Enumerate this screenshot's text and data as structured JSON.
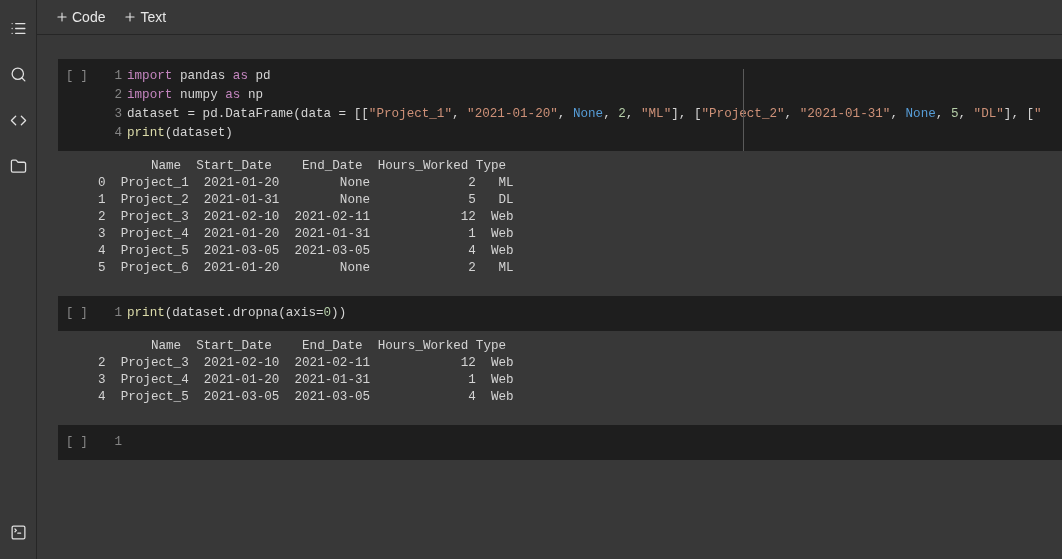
{
  "toolbar": {
    "buttons": [
      {
        "label": "Code"
      },
      {
        "label": "Text"
      }
    ]
  },
  "cells": [
    {
      "run_marker": "[ ]",
      "lines": [
        {
          "number": "1",
          "tokens": [
            {
              "t": "import",
              "kind": "keyword"
            },
            {
              "t": " pandas ",
              "kind": "plain"
            },
            {
              "t": "as",
              "kind": "keyword"
            },
            {
              "t": " pd",
              "kind": "plain"
            }
          ]
        },
        {
          "number": "2",
          "tokens": [
            {
              "t": "import",
              "kind": "keyword"
            },
            {
              "t": " numpy ",
              "kind": "plain"
            },
            {
              "t": "as",
              "kind": "keyword"
            },
            {
              "t": " np",
              "kind": "plain"
            }
          ]
        },
        {
          "number": "3",
          "tokens": [
            {
              "t": "dataset = pd.DataFrame(data = [[",
              "kind": "plain"
            },
            {
              "t": "\"Project_1\"",
              "kind": "string"
            },
            {
              "t": ", ",
              "kind": "plain"
            },
            {
              "t": "\"2021-01-20\"",
              "kind": "string"
            },
            {
              "t": ", ",
              "kind": "plain"
            },
            {
              "t": "None",
              "kind": "constant"
            },
            {
              "t": ", ",
              "kind": "plain"
            },
            {
              "t": "2",
              "kind": "number"
            },
            {
              "t": ", ",
              "kind": "plain"
            },
            {
              "t": "\"ML\"",
              "kind": "string"
            },
            {
              "t": "], [",
              "kind": "plain"
            },
            {
              "t": "\"Project_2\"",
              "kind": "string"
            },
            {
              "t": ", ",
              "kind": "plain"
            },
            {
              "t": "\"2021-01-31\"",
              "kind": "string"
            },
            {
              "t": ", ",
              "kind": "plain"
            },
            {
              "t": "None",
              "kind": "constant"
            },
            {
              "t": ", ",
              "kind": "plain"
            },
            {
              "t": "5",
              "kind": "number"
            },
            {
              "t": ", ",
              "kind": "plain"
            },
            {
              "t": "\"DL\"",
              "kind": "string"
            },
            {
              "t": "], [",
              "kind": "plain"
            },
            {
              "t": "\"",
              "kind": "string"
            }
          ]
        },
        {
          "number": "4",
          "tokens": [
            {
              "t": "print",
              "kind": "function"
            },
            {
              "t": "(dataset)",
              "kind": "plain"
            }
          ]
        }
      ],
      "output": [
        "       Name  Start_Date    End_Date  Hours_Worked Type",
        "0  Project_1  2021-01-20        None             2   ML",
        "1  Project_2  2021-01-31        None             5   DL",
        "2  Project_3  2021-02-10  2021-02-11            12  Web",
        "3  Project_4  2021-01-20  2021-01-31             1  Web",
        "4  Project_5  2021-03-05  2021-03-05             4  Web",
        "5  Project_6  2021-01-20        None             2   ML"
      ]
    },
    {
      "run_marker": "[ ]",
      "lines": [
        {
          "number": "1",
          "tokens": [
            {
              "t": "print",
              "kind": "function"
            },
            {
              "t": "(dataset.dropna(axis=",
              "kind": "plain"
            },
            {
              "t": "0",
              "kind": "number"
            },
            {
              "t": "))",
              "kind": "plain"
            }
          ]
        }
      ],
      "output": [
        "       Name  Start_Date    End_Date  Hours_Worked Type",
        "2  Project_3  2021-02-10  2021-02-11            12  Web",
        "3  Project_4  2021-01-20  2021-01-31             1  Web",
        "4  Project_5  2021-03-05  2021-03-05             4  Web"
      ]
    },
    {
      "run_marker": "[ ]",
      "lines": [
        {
          "number": "1"
        }
      ]
    }
  ]
}
